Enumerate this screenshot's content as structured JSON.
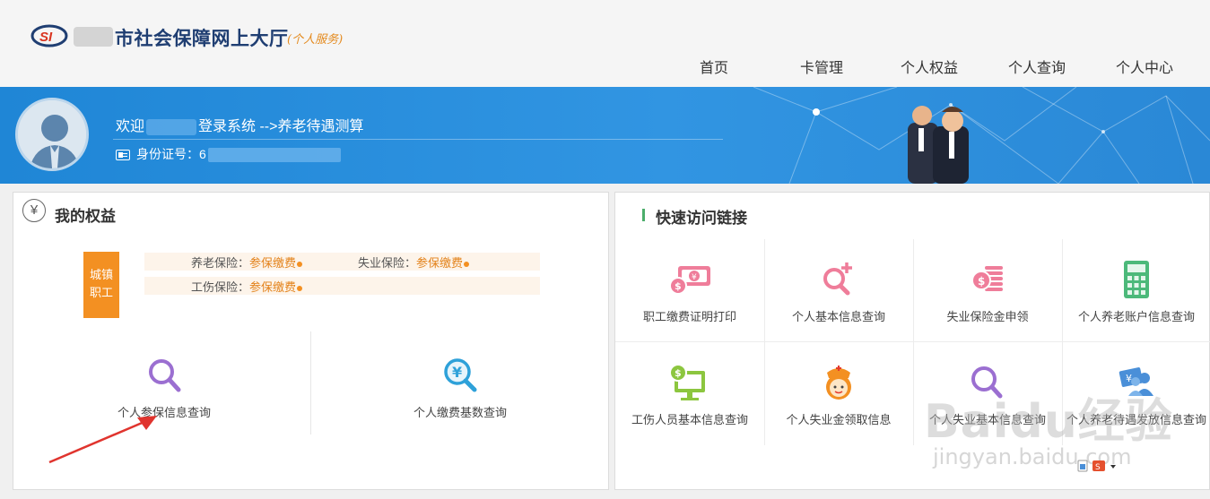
{
  "header": {
    "title": "市社会保障网上大厅",
    "subtitle": "(个人服务)",
    "logo_text": "SI"
  },
  "nav": [
    {
      "label": "首页"
    },
    {
      "label": "卡管理"
    },
    {
      "label": "个人权益"
    },
    {
      "label": "个人查询"
    },
    {
      "label": "个人中心"
    }
  ],
  "banner": {
    "welcome_prefix": "欢迎",
    "welcome_suffix": "登录系统 -->养老待遇测算",
    "id_label": "身份证号：6"
  },
  "rights": {
    "title": "我的权益",
    "badge_line1": "城镇",
    "badge_line2": "职工",
    "insurances": [
      {
        "label": "养老保险：",
        "status": "参保缴费"
      },
      {
        "label": "失业保险：",
        "status": "参保缴费"
      },
      {
        "label": "工伤保险：",
        "status": "参保缴费"
      }
    ],
    "tiles": [
      {
        "label": "个人参保信息查询",
        "icon": "search-icon"
      },
      {
        "label": "个人缴费基数查询",
        "icon": "yen-search-icon"
      }
    ]
  },
  "quick": {
    "title": "快速访问链接",
    "links": [
      {
        "label": "职工缴费证明打印",
        "icon": "money-bill-icon"
      },
      {
        "label": "个人基本信息查询",
        "icon": "search-plus-icon"
      },
      {
        "label": "失业保险金申领",
        "icon": "coin-stack-icon"
      },
      {
        "label": "个人养老账户信息查询",
        "icon": "calculator-icon"
      },
      {
        "label": "工伤人员基本信息查询",
        "icon": "monitor-dollar-icon"
      },
      {
        "label": "个人失业金领取信息",
        "icon": "nurse-icon"
      },
      {
        "label": "个人失业基本信息查询",
        "icon": "search-icon"
      },
      {
        "label": "个人养老待遇发放信息查询",
        "icon": "payment-person-icon"
      }
    ]
  },
  "watermark": {
    "brand": "Baidu经验",
    "url": "jingyan.baidu.com"
  },
  "colors": {
    "brand_navy": "#1f3e72",
    "banner_blue": "#2a8ad8",
    "accent_orange": "#f39022",
    "accent_green": "#4cae6b",
    "purple": "#9b6fd1",
    "pink": "#ef7d9a"
  }
}
